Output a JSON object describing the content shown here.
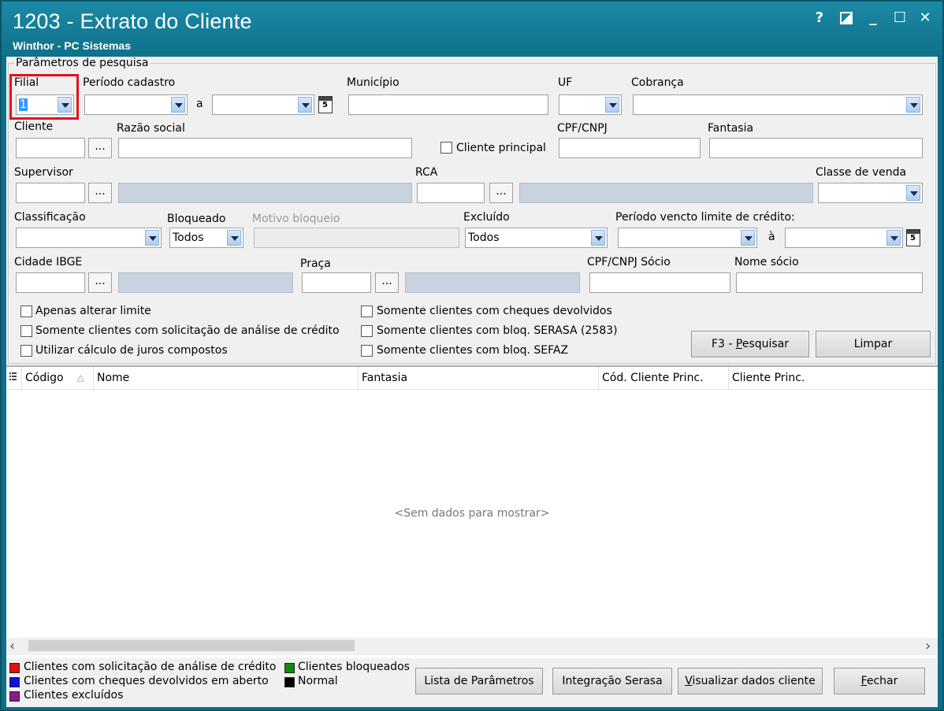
{
  "window": {
    "title": "1203 - Extrato do Cliente",
    "subtitle": "Winthor - PC Sistemas",
    "help": "?",
    "minimize": "_",
    "maximize": "☐",
    "close": "✕"
  },
  "params": {
    "group_title": "Parâmetros de pesquisa",
    "filial_label": "Filial",
    "filial_value": "1",
    "periodo_cadastro_label": "Período cadastro",
    "a_label": "a",
    "municipio_label": "Município",
    "uf_label": "UF",
    "cobranca_label": "Cobrança",
    "cliente_label": "Cliente",
    "razao_social_label": "Razão social",
    "cliente_principal_label": "Cliente principal",
    "cpf_cnpj_label": "CPF/CNPJ",
    "fantasia_label": "Fantasia",
    "supervisor_label": "Supervisor",
    "rca_label": "RCA",
    "classe_venda_label": "Classe de venda",
    "classificacao_label": "Classificação",
    "bloqueado_label": "Bloqueado",
    "bloqueado_value": "Todos",
    "motivo_bloqueio_label": "Motivo bloqueio",
    "excluido_label": "Excluído",
    "excluido_value": "Todos",
    "periodo_vencto_label": "Período vencto limite de crédito:",
    "a2_label": "à",
    "cidade_ibge_label": "Cidade IBGE",
    "praca_label": "Praça",
    "cpf_socio_label": "CPF/CNPJ Sócio",
    "nome_socio_label": "Nome sócio",
    "ellipsis": "...",
    "chk_alterar_limite": "Apenas alterar limite",
    "chk_solicitacao": "Somente clientes com solicitação de análise de crédito",
    "chk_juros": "Utilizar cálculo de juros compostos",
    "chk_cheques": "Somente clientes com cheques devolvidos",
    "chk_serasa": "Somente clientes com bloq. SERASA (2583)",
    "chk_sefaz": "Somente clientes com bloq. SEFAZ",
    "btn_pesquisar_prefix": "F3 - ",
    "btn_pesquisar_u": "P",
    "btn_pesquisar_rest": "esquisar",
    "btn_limpar": "Limpar"
  },
  "grid": {
    "columns": [
      "Código",
      "Nome",
      "Fantasia",
      "Cód. Cliente Princ.",
      "Cliente Princ."
    ],
    "empty_text": "<Sem dados para mostrar>",
    "scroll_left": "‹",
    "scroll_right": "›"
  },
  "legend": {
    "items": [
      {
        "label": "Clientes com solicitação de análise de crédito",
        "color": "#e01010"
      },
      {
        "label": "Clientes com cheques devolvidos em aberto",
        "color": "#1010e0"
      },
      {
        "label": "Clientes excluídos",
        "color": "#8a1a8a"
      },
      {
        "label": "Clientes bloqueados",
        "color": "#108a10"
      },
      {
        "label": "Normal",
        "color": "#000000"
      }
    ]
  },
  "footer": {
    "lista_parametros": "Lista de Parâmetros",
    "integracao_serasa": "Integração Serasa",
    "visualizar_u": "V",
    "visualizar_rest": "isualizar dados cliente",
    "fechar_u": "F",
    "fechar_rest": "echar"
  },
  "colors": {
    "title_bar": "#0f7089",
    "highlight": "#e5101d",
    "lookup_gray": "#c9d3df"
  }
}
